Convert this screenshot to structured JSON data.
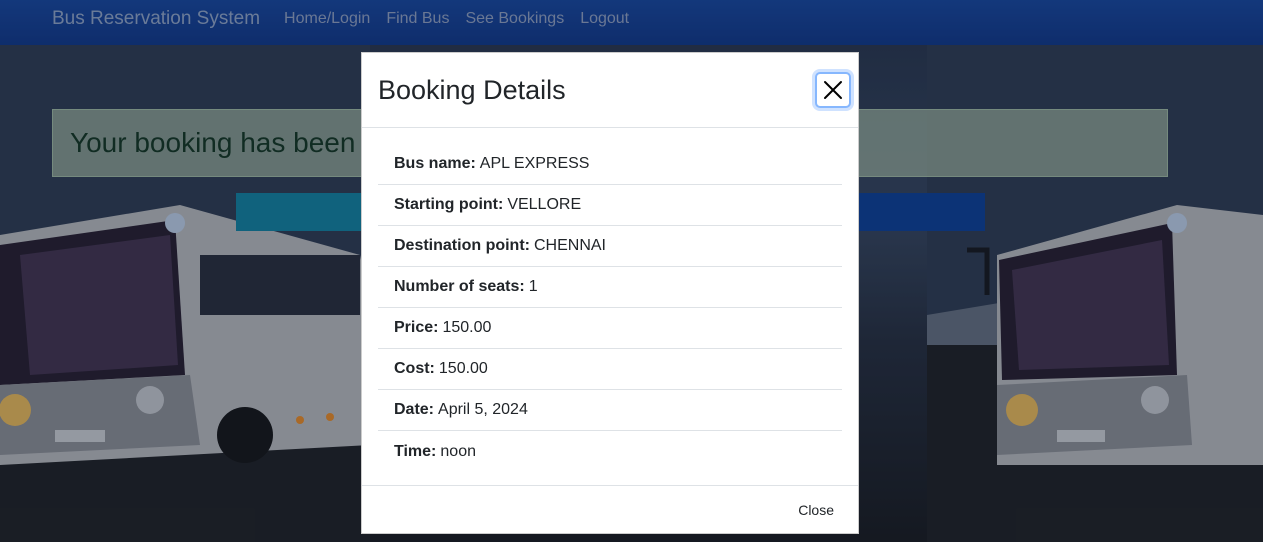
{
  "navbar": {
    "brand": "Bus Reservation System",
    "links": [
      "Home/Login",
      "Find Bus",
      "See Bookings",
      "Logout"
    ]
  },
  "alert": {
    "text": "Your booking has been"
  },
  "modal": {
    "title": "Booking Details",
    "details": [
      {
        "label": "Bus name:",
        "value": "APL EXPRESS"
      },
      {
        "label": "Starting point:",
        "value": "VELLORE"
      },
      {
        "label": "Destination point:",
        "value": "CHENNAI"
      },
      {
        "label": "Number of seats:",
        "value": "1"
      },
      {
        "label": "Price:",
        "value": "150.00"
      },
      {
        "label": "Cost:",
        "value": "150.00"
      },
      {
        "label": "Date:",
        "value": "April 5, 2024"
      },
      {
        "label": "Time:",
        "value": "noon"
      }
    ],
    "close_label": "Close"
  },
  "colors": {
    "navbar": "#123e98",
    "alert_bg": "#cde6c8",
    "alert_text": "#163d28",
    "button_teal": "#1590b2",
    "button_blue": "#0f47a8",
    "focus_ring": "#86b7fe"
  },
  "icons": {
    "modal_close": "close-icon"
  }
}
